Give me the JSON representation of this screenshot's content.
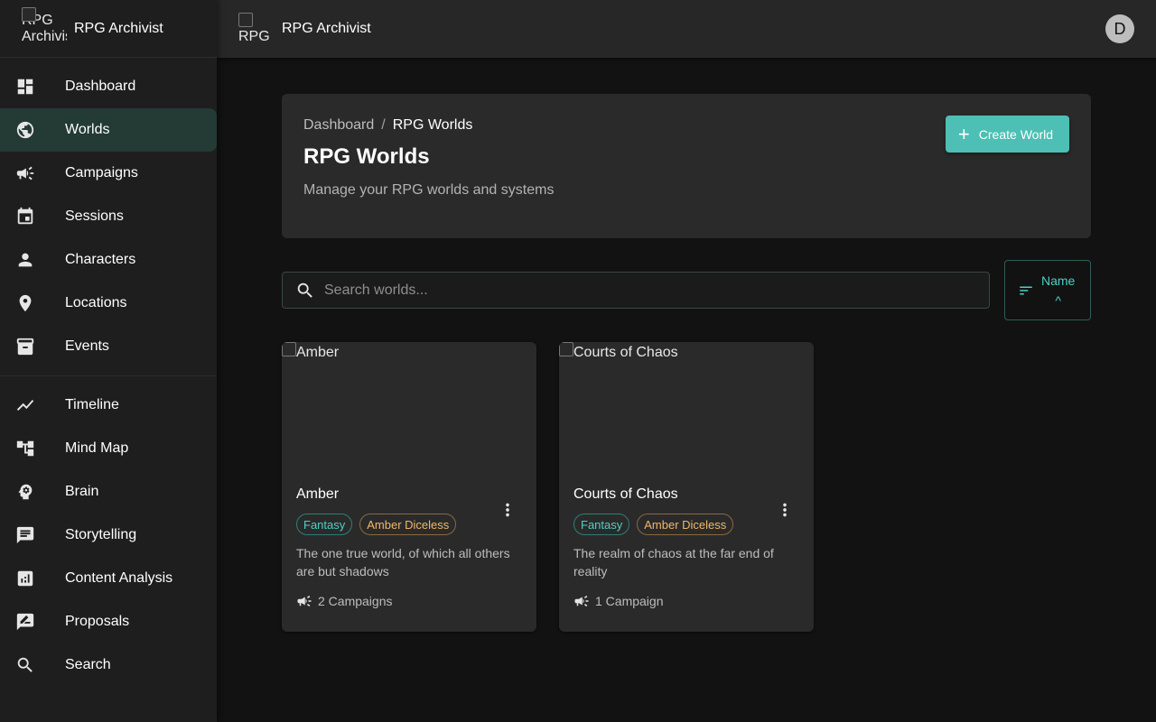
{
  "app": {
    "name": "RPG Archivist",
    "logo_alt": "RPG Archivist",
    "avatar_initial": "D"
  },
  "sidebar": {
    "primary": [
      {
        "label": "Dashboard",
        "icon": "dashboard-icon",
        "active": false
      },
      {
        "label": "Worlds",
        "icon": "globe-icon",
        "active": true
      },
      {
        "label": "Campaigns",
        "icon": "campaign-icon",
        "active": false
      },
      {
        "label": "Sessions",
        "icon": "calendar-icon",
        "active": false
      },
      {
        "label": "Characters",
        "icon": "person-icon",
        "active": false
      },
      {
        "label": "Locations",
        "icon": "location-pin-icon",
        "active": false
      },
      {
        "label": "Events",
        "icon": "archive-icon",
        "active": false
      }
    ],
    "secondary": [
      {
        "label": "Timeline",
        "icon": "timeline-icon"
      },
      {
        "label": "Mind Map",
        "icon": "account-tree-icon"
      },
      {
        "label": "Brain",
        "icon": "psychology-icon"
      },
      {
        "label": "Storytelling",
        "icon": "chat-icon"
      },
      {
        "label": "Content Analysis",
        "icon": "analytics-icon"
      },
      {
        "label": "Proposals",
        "icon": "rate-review-icon"
      },
      {
        "label": "Search",
        "icon": "search-icon"
      }
    ]
  },
  "header": {
    "breadcrumb": {
      "root": "Dashboard",
      "separator": "/",
      "current": "RPG Worlds"
    },
    "title": "RPG Worlds",
    "subtitle": "Manage your RPG worlds and systems",
    "create_button": "Create World"
  },
  "search": {
    "placeholder": "Search worlds...",
    "value": ""
  },
  "sort": {
    "label": "Name",
    "direction": "^"
  },
  "worlds": [
    {
      "image_alt": "Amber",
      "name": "Amber",
      "genre": "Fantasy",
      "system": "Amber Diceless",
      "description": "The one true world, of which all others are but shadows",
      "campaigns": "2 Campaigns"
    },
    {
      "image_alt": "Courts of Chaos",
      "name": "Courts of Chaos",
      "genre": "Fantasy",
      "system": "Amber Diceless",
      "description": "The realm of chaos at the far end of reality",
      "campaigns": "1 Campaign"
    }
  ],
  "colors": {
    "accent": "#4dbfb4",
    "genre_chip": "#4dd0c4",
    "system_chip": "#f0b866",
    "active_nav_bg": "#233a35"
  }
}
